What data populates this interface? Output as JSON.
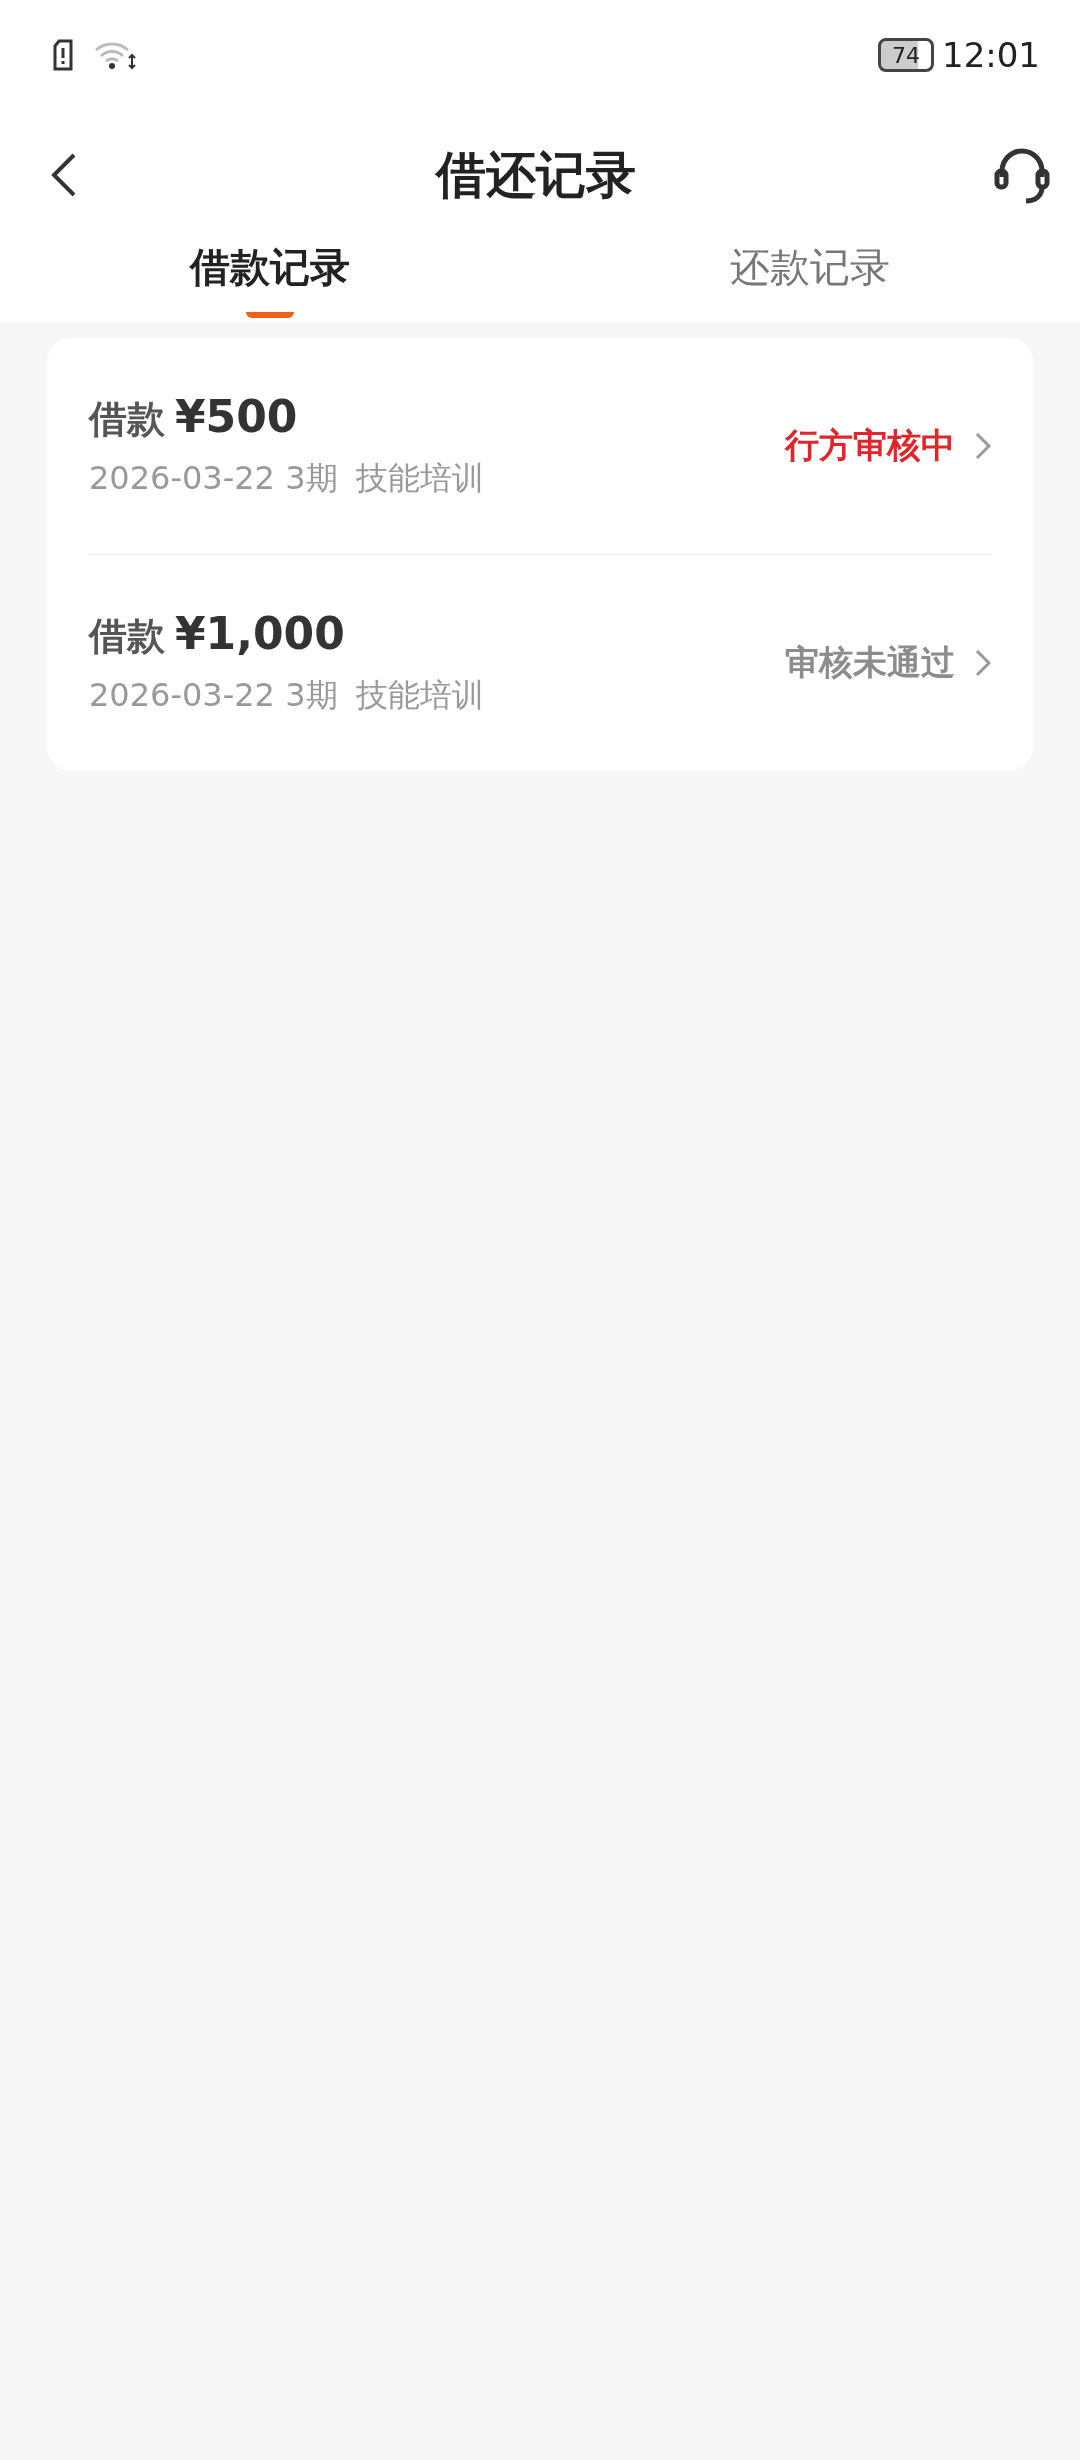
{
  "status_bar": {
    "battery": "74",
    "time": "12:01"
  },
  "header": {
    "title": "借还记录"
  },
  "tabs": [
    {
      "label": "借款记录",
      "selected": true
    },
    {
      "label": "还款记录",
      "selected": false
    }
  ],
  "records": [
    {
      "label": "借款",
      "amount": "¥500",
      "date": "2026-03-22 3期",
      "purpose": "技能培训",
      "status": "行方审核中",
      "color": "#e0262b"
    },
    {
      "label": "借款",
      "amount": "¥1,000",
      "date": "2026-03-22 3期",
      "purpose": "技能培训",
      "status": "审核未通过",
      "color": "#8c8c8c"
    }
  ]
}
